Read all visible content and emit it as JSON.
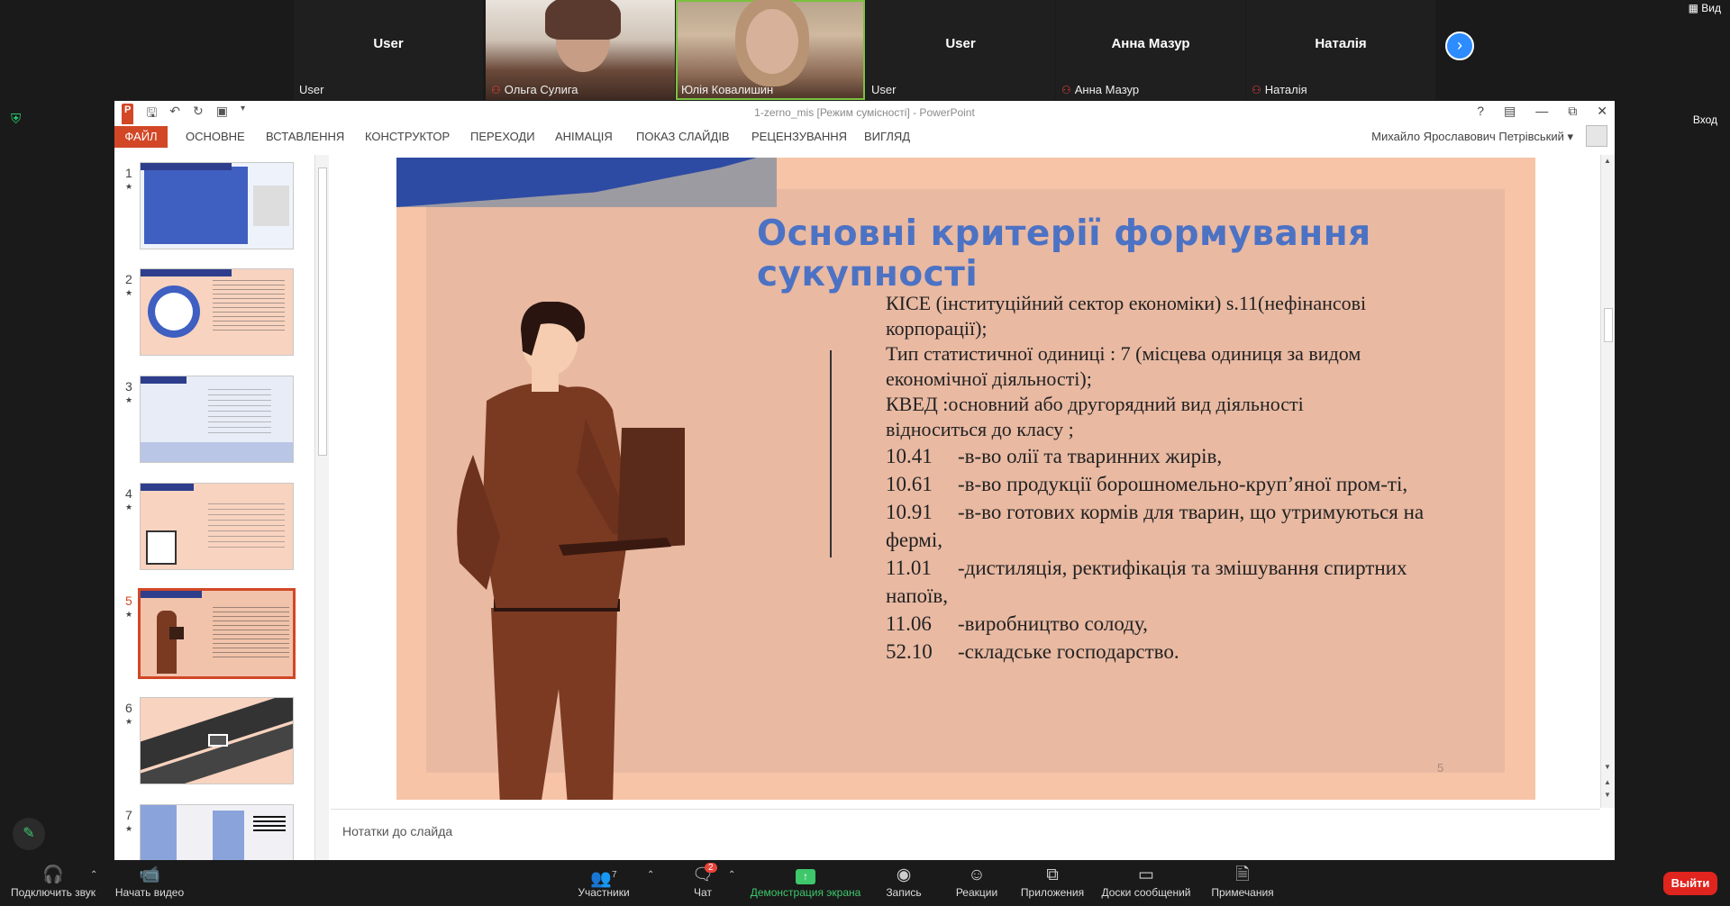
{
  "participants": [
    {
      "big": "User",
      "small": "User",
      "muted": false
    },
    {
      "big": "",
      "small": "Ольга Сулига",
      "muted": true
    },
    {
      "big": "",
      "small": "Юлія Ковалишин",
      "muted": false
    },
    {
      "big": "User",
      "small": "User",
      "muted": false
    },
    {
      "big": "Анна Мазур",
      "small": "Анна Мазур",
      "muted": true
    },
    {
      "big": "Наталія",
      "small": "Наталія",
      "muted": true
    }
  ],
  "top_right": {
    "view": "Вид",
    "enter": "Вход"
  },
  "ppt": {
    "window_title": "1-zerno_mis [Режим сумісності] - PowerPoint",
    "file_tab": "ФАЙЛ",
    "tabs": [
      "ОСНОВНЕ",
      "ВСТАВЛЕННЯ",
      "КОНСТРУКТОР",
      "ПЕРЕХОДИ",
      "АНІМАЦІЯ",
      "ПОКАЗ СЛАЙДІВ",
      "РЕЦЕНЗУВАННЯ",
      "ВИГЛЯД"
    ],
    "user_name": "Михайло Ярославович Петрівський",
    "thumbnails": [
      "1",
      "2",
      "3",
      "4",
      "5",
      "6",
      "7"
    ],
    "selected_slide": "5",
    "notes_placeholder": "Нотатки до слайда"
  },
  "slide": {
    "title": "Основні критерії формування сукупності",
    "intro_lines": [
      "КІСЕ (інституційний сектор економіки) s.11(нефінансові",
      "корпорації);",
      "Тип статистичної одиниці :  7 (місцева одиниця за видом",
      "економічної діяльності);",
      "КВЕД :основний або другорядний вид діяльності",
      "відноситься до класу ;"
    ],
    "codes": [
      {
        "code": "10.41",
        "text": "-в-во олії та тваринних жирів,"
      },
      {
        "code": "10.61",
        "text": "-в-во продукції борошномельно-круп’яної пром-ті,"
      },
      {
        "code": "10.91",
        "text": "-в-во готових кормів для тварин, що утримуються на"
      },
      {
        "code": "",
        "text": "фермі,"
      },
      {
        "code": "11.01",
        "text": "-дистиляція, ректифікація та змішування спиртних"
      },
      {
        "code": "",
        "text": "напоїв,"
      },
      {
        "code": "11.06",
        "text": "-виробництво солоду,"
      },
      {
        "code": "52.10",
        "text": "-складське господарство."
      }
    ],
    "page_number": "5"
  },
  "toolbar": {
    "audio": "Подключить звук",
    "video": "Начать видео",
    "participants": "Участники",
    "participants_count": "7",
    "chat": "Чат",
    "chat_badge": "2",
    "share": "Демонстрация экрана",
    "record": "Запись",
    "reactions": "Реакции",
    "apps": "Приложения",
    "whiteboards": "Доски сообщений",
    "notes": "Примечания",
    "leave": "Выйти"
  }
}
